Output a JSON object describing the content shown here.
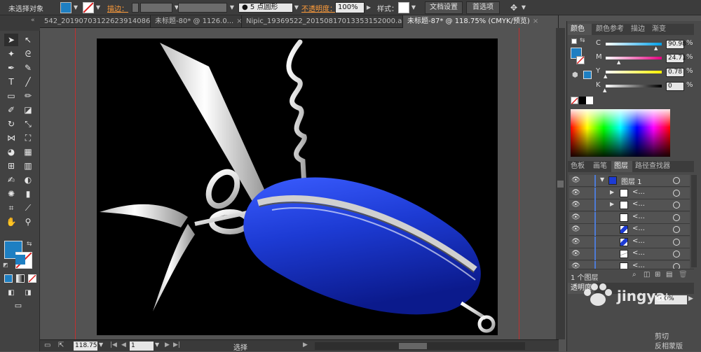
{
  "control_bar": {
    "selection_status": "未选择对象",
    "stroke_label": "描边：",
    "stroke_profile": "5 点圆形",
    "opacity_label": "不透明度：",
    "opacity_value": "100%",
    "style_label": "样式：",
    "doc_settings_button": "文档设置",
    "preferences_button": "首选项"
  },
  "tabs": [
    {
      "label": "542_20190703122623914086.ai*",
      "active": false
    },
    {
      "label": "未标题-80* @ 1126.0...",
      "active": false
    },
    {
      "label": "Nipic_19369522_20150817013353152000.ai*",
      "active": false
    },
    {
      "label": "未标题-87* @ 118.75% (CMYK/预览)",
      "active": true
    }
  ],
  "status_bar": {
    "zoom": "118.75",
    "page": "1",
    "mode_text": "选择"
  },
  "color_panel": {
    "tabs": [
      "颜色",
      "颜色参考",
      "描边",
      "渐变"
    ],
    "channels": [
      {
        "label": "C",
        "value": "90.98",
        "level": 0.91,
        "color": "#00a0e9"
      },
      {
        "label": "M",
        "value": "24.71",
        "level": 0.25,
        "color": "#e4007f"
      },
      {
        "label": "Y",
        "value": "0.78",
        "level": 0.01,
        "color": "#fff100"
      },
      {
        "label": "K",
        "value": "0",
        "level": 0.0,
        "color": "#000000"
      }
    ],
    "fill_color": "#1e7fc2"
  },
  "layers_panel": {
    "tabs": [
      "色板",
      "画笔",
      "图层",
      "路径查找器"
    ],
    "layer_name": "图层 1",
    "sublayer_label": "<...",
    "count_label": "1 个图层",
    "rows": [
      {
        "name": "图层 1",
        "thumb": "layer"
      },
      {
        "name": "<...",
        "thumb": "white"
      },
      {
        "name": "<...",
        "thumb": "white"
      },
      {
        "name": "<...",
        "thumb": "white"
      },
      {
        "name": "<...",
        "thumb": "blue"
      },
      {
        "name": "<...",
        "thumb": "blue"
      },
      {
        "name": "<...",
        "thumb": "blade"
      },
      {
        "name": "<...",
        "thumb": "white"
      }
    ]
  },
  "transparency_panel": {
    "title": "透明度",
    "opacity": "100%",
    "option_1": "剪切",
    "option_2": "反相蒙版"
  },
  "watermark": "jingyan",
  "accent_color": "#1e7fc2"
}
